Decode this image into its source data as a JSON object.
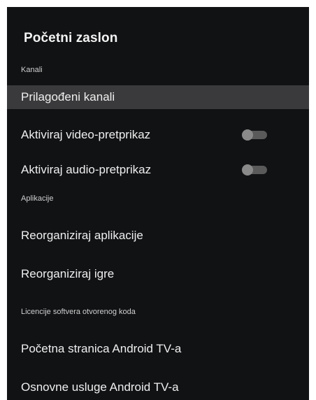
{
  "header": {
    "title": "Početni zaslon"
  },
  "sections": {
    "channels": "Kanali",
    "apps": "Aplikacije",
    "licenses": "Licencije softvera otvorenog koda"
  },
  "items": {
    "custom_channels": "Prilagođeni kanali",
    "video_preview": {
      "label": "Aktiviraj video-pretprikaz",
      "enabled": false
    },
    "audio_preview": {
      "label": "Aktiviraj audio-pretprikaz",
      "enabled": false
    },
    "reorder_apps": "Reorganiziraj aplikacije",
    "reorder_games": "Reorganiziraj igre",
    "android_tv_home": "Početna stranica Android TV-a",
    "android_tv_core": "Osnovne usluge Android TV-a"
  },
  "colors": {
    "background": "#111214",
    "focus_highlight": "#3a3a3c",
    "toggle_off_track": "#5a5a5a",
    "toggle_off_thumb": "#8a8a8a"
  }
}
